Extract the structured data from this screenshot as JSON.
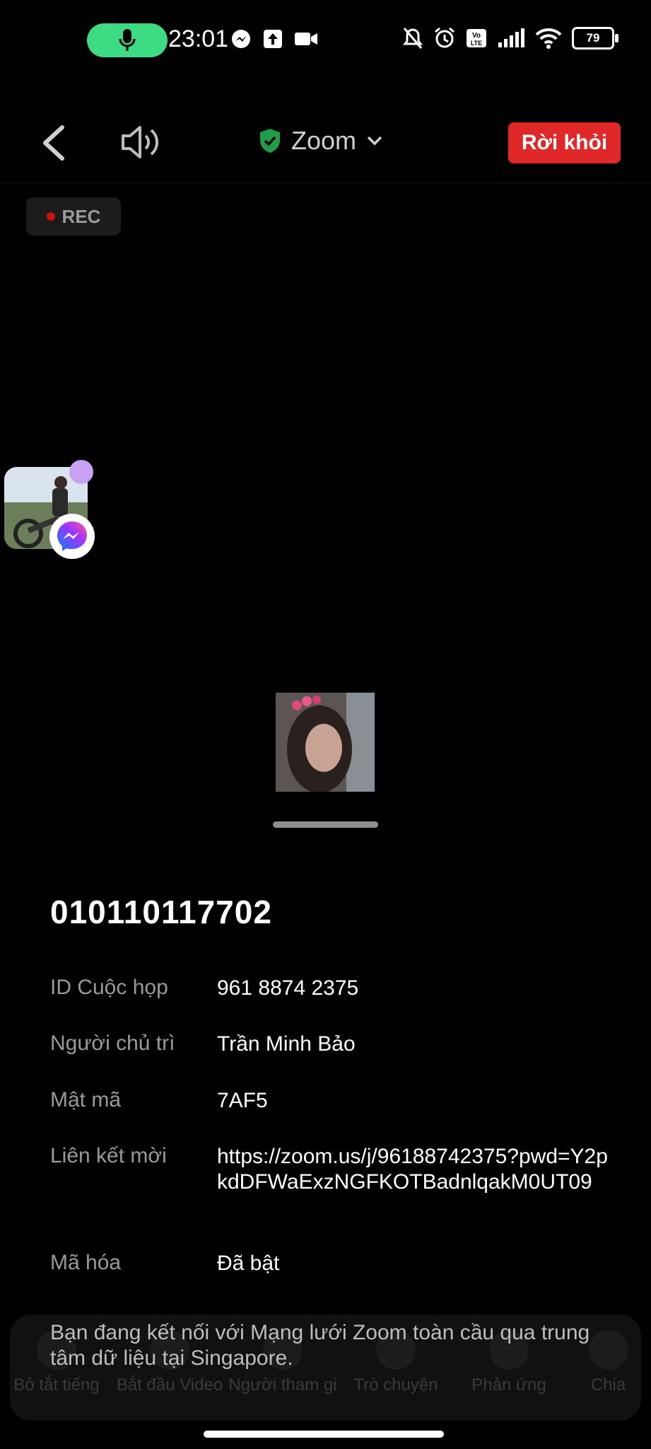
{
  "status_bar": {
    "time": "23:01",
    "battery_level": "79",
    "icons_left": [
      "messenger-icon",
      "upload-icon",
      "video-icon"
    ],
    "icons_right": [
      "mute-bell-icon",
      "alarm-icon",
      "volte-icon",
      "signal-icon",
      "wifi-icon"
    ]
  },
  "top_bar": {
    "title": "Zoom",
    "leave_label": "Rời khỏi",
    "rec_label": "REC"
  },
  "meeting": {
    "title": "010110117702",
    "rows": [
      {
        "label": "ID Cuộc họp",
        "value": "961 8874 2375"
      },
      {
        "label": "Người chủ trì",
        "value": "Trần Minh Bảo"
      },
      {
        "label": "Mật mã",
        "value": "7AF5"
      },
      {
        "label": "Liên kết mời",
        "value": "https://zoom.us/j/96188742375?pwd=Y2pkdDFWaExzNGFKOTBadnlqakM0UT09"
      },
      {
        "label": "Mã hóa",
        "value": "Đã bật"
      }
    ],
    "footnote": "Bạn đang kết nối với Mạng lưới Zoom toàn cầu qua trung tâm dữ liệu tại Singapore."
  },
  "toolbar": {
    "items": [
      {
        "label": "Bỏ tắt tiếng"
      },
      {
        "label": "Bắt đầu Video"
      },
      {
        "label": "Người tham gi"
      },
      {
        "label": "Trò chuyện"
      },
      {
        "label": "Phản ứng"
      },
      {
        "label": "Chia"
      }
    ]
  },
  "colors": {
    "accent_green": "#3ddc84",
    "leave_red": "#e02828",
    "shield_green": "#1f9d48"
  }
}
